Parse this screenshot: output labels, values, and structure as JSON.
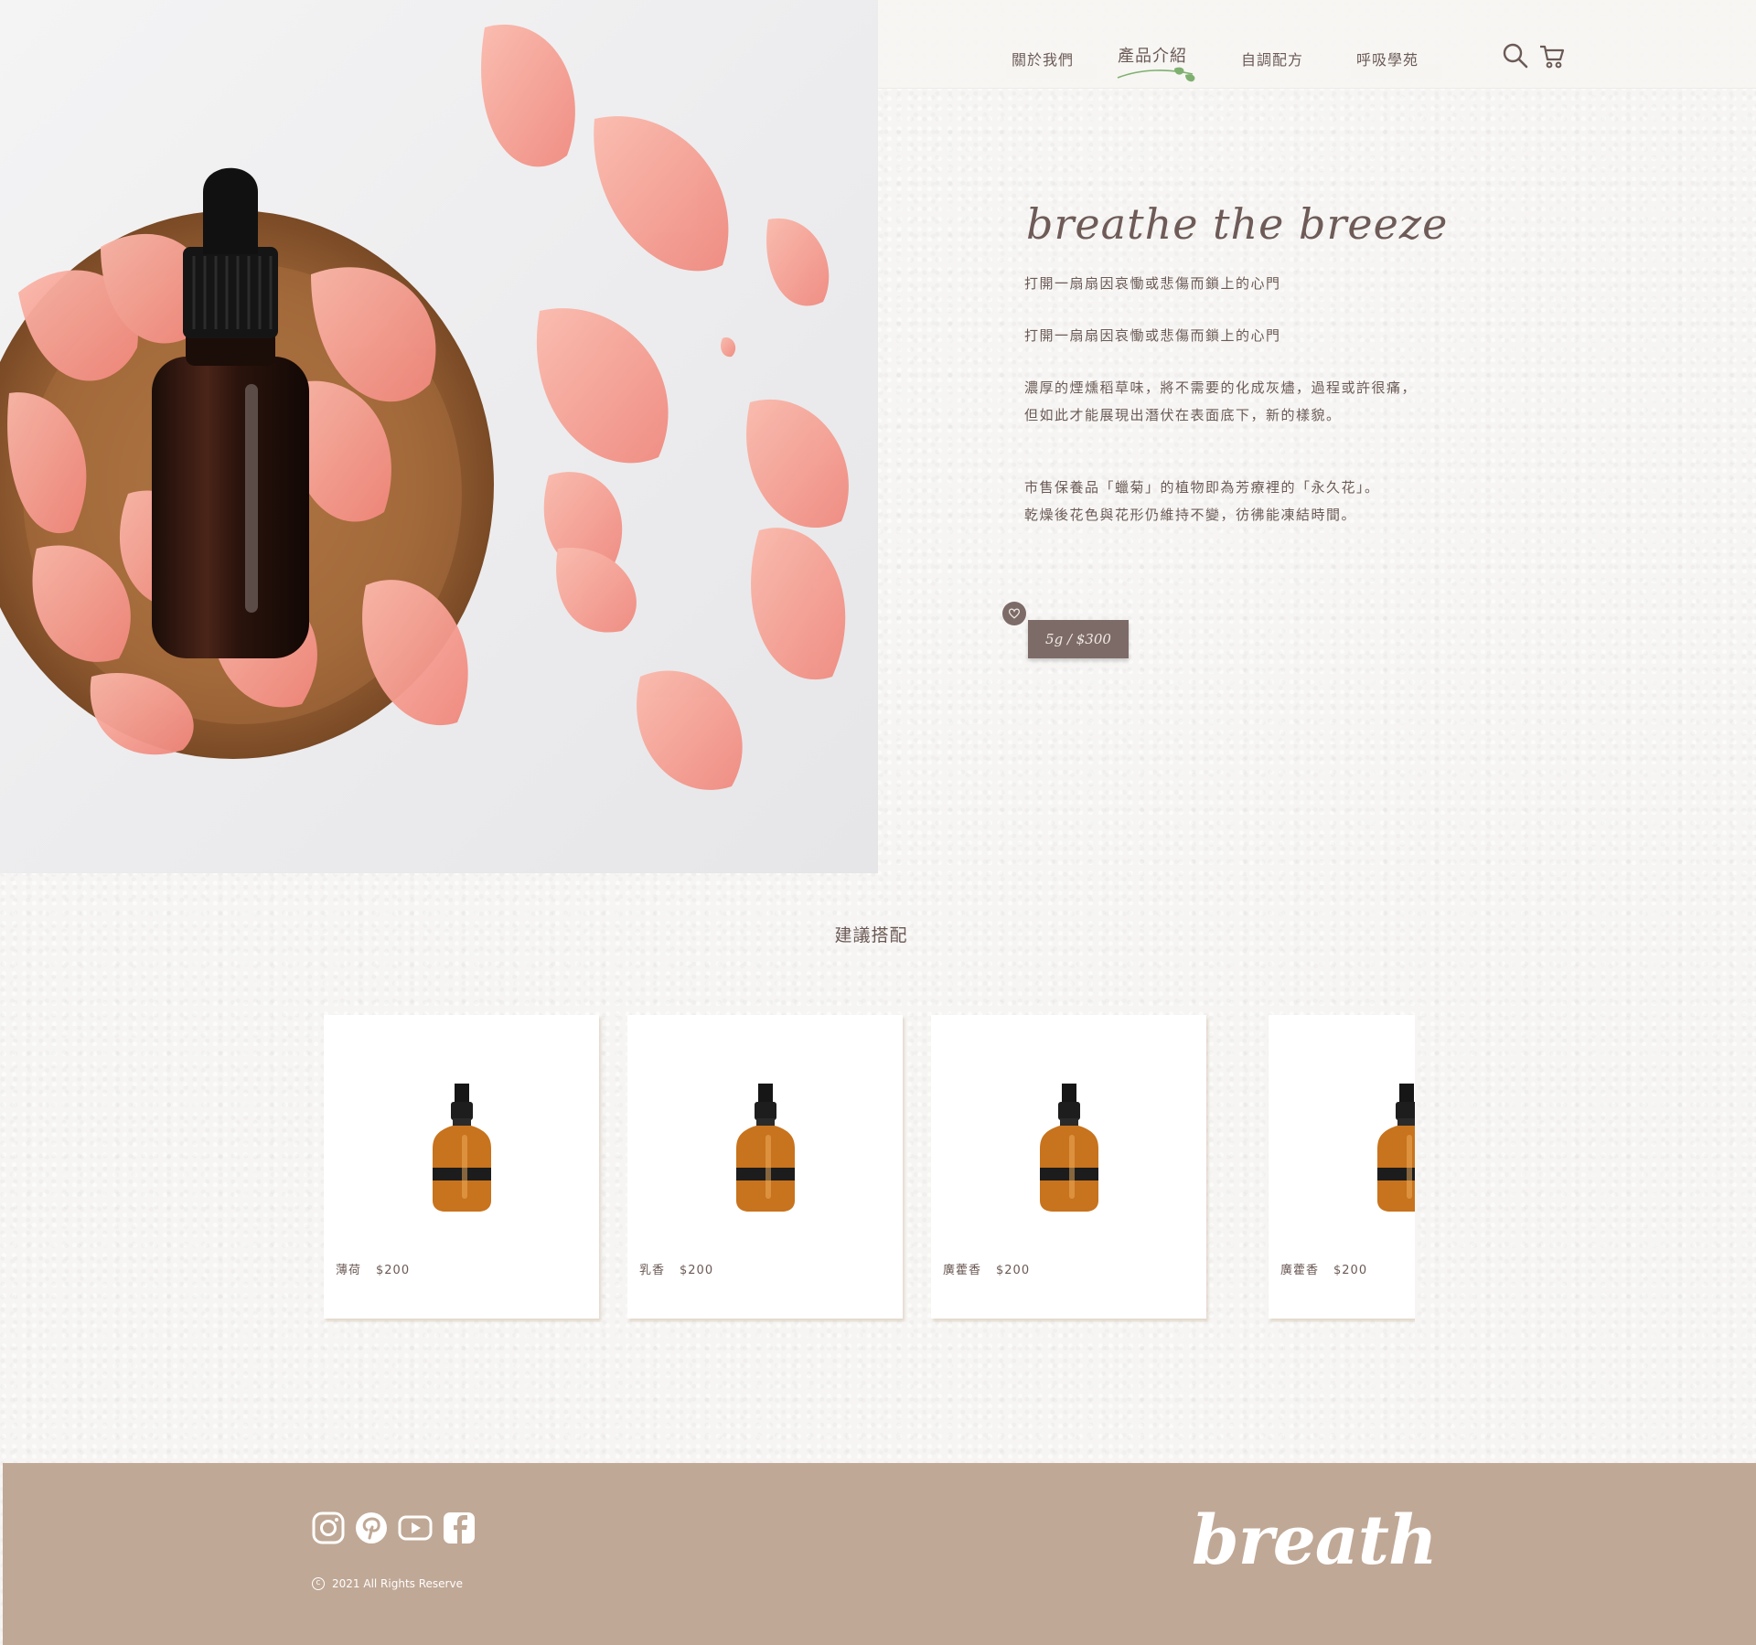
{
  "nav": {
    "items": [
      {
        "label": "關於我們",
        "active": false
      },
      {
        "label": "產品介紹",
        "active": true
      },
      {
        "label": "自調配方",
        "active": false
      },
      {
        "label": "呼吸學苑",
        "active": false
      }
    ],
    "icons": [
      "search-icon",
      "cart-icon"
    ]
  },
  "hero": {
    "title": "breathe the breeze",
    "lines": [
      "打開一扇扇因哀慟或悲傷而鎖上的心門",
      "打開一扇扇因哀慟或悲傷而鎖上的心門",
      "濃厚的煙燻稻草味，將不需要的化成灰燼，過程或許很痛，",
      "但如此才能展現出潛伏在表面底下，新的樣貌。",
      "市售保養品「蠟菊」的植物即為芳療裡的「永久花」。",
      "乾燥後花色與花形仍維持不變，彷彿能凍結時間。"
    ],
    "price": "5g / $300",
    "image_alt": "amber dropper bottle on wooden plate with rose petals"
  },
  "suggest": {
    "title": "建議搭配",
    "products": [
      {
        "name": "薄荷",
        "price": "$200"
      },
      {
        "name": "乳香",
        "price": "$200"
      },
      {
        "name": "廣藿香",
        "price": "$200"
      },
      {
        "name": "廣藿香",
        "price": "$200"
      }
    ]
  },
  "footer": {
    "social": [
      "instagram-icon",
      "pinterest-icon",
      "youtube-icon",
      "facebook-icon"
    ],
    "copyright": "2021 All Rights Reserve",
    "logo": "breath"
  },
  "colors": {
    "text": "#6b5a55",
    "accent": "#7d6b67",
    "footer": "#c0a896",
    "background": "#f6f5f3",
    "nav_underline": "#7fb06f"
  }
}
